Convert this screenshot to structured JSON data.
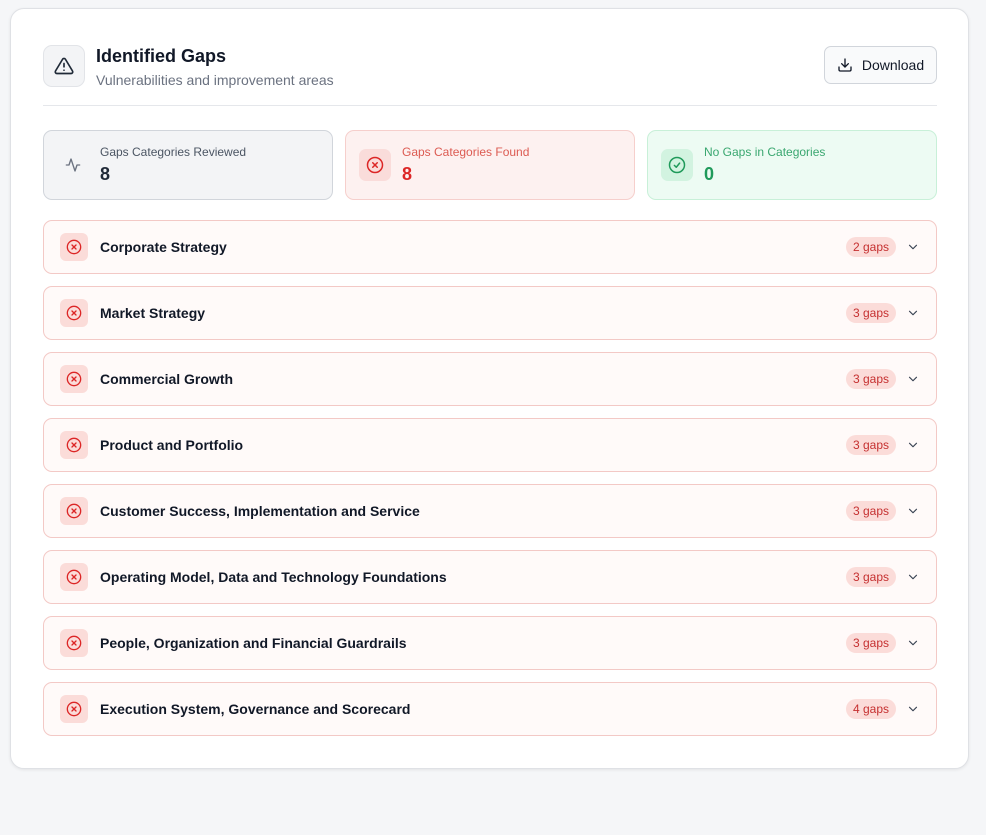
{
  "header": {
    "title": "Identified Gaps",
    "subtitle": "Vulnerabilities and improvement areas",
    "download_label": "Download",
    "icon": "alert-triangle-icon"
  },
  "stats": [
    {
      "label": "Gaps Categories Reviewed",
      "value": "8",
      "icon": "activity-icon",
      "tone": "neutral"
    },
    {
      "label": "Gaps Categories Found",
      "value": "8",
      "icon": "x-circle-icon",
      "tone": "danger"
    },
    {
      "label": "No Gaps in Categories",
      "value": "0",
      "icon": "check-circle-icon",
      "tone": "success"
    }
  ],
  "categories": [
    {
      "name": "Corporate Strategy",
      "badge": "2 gaps"
    },
    {
      "name": "Market Strategy",
      "badge": "3 gaps"
    },
    {
      "name": "Commercial Growth",
      "badge": "3 gaps"
    },
    {
      "name": "Product and Portfolio",
      "badge": "3 gaps"
    },
    {
      "name": "Customer Success, Implementation and Service",
      "badge": "3 gaps"
    },
    {
      "name": "Operating Model, Data and Technology Foundations",
      "badge": "3 gaps"
    },
    {
      "name": "People, Organization and Financial Guardrails",
      "badge": "3 gaps"
    },
    {
      "name": "Execution System, Governance and Scorecard",
      "badge": "4 gaps"
    }
  ],
  "colors": {
    "danger": "#dc2626",
    "success": "#1f9a5a",
    "neutral": "#1f2937"
  }
}
